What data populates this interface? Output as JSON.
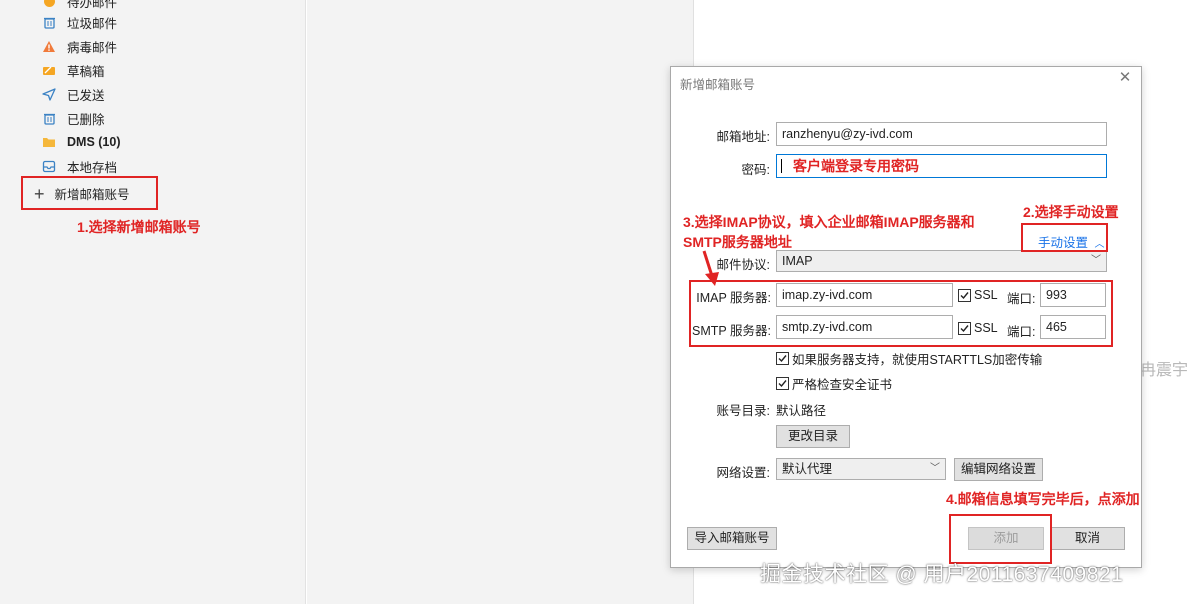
{
  "sidebar": {
    "folders": [
      {
        "label": "待办邮件",
        "icon": "todo-icon"
      },
      {
        "label": "垃圾邮件",
        "icon": "trash-icon"
      },
      {
        "label": "病毒邮件",
        "icon": "warning-icon"
      },
      {
        "label": "草稿箱",
        "icon": "draft-icon"
      },
      {
        "label": "已发送",
        "icon": "send-icon"
      },
      {
        "label": "已删除",
        "icon": "deleted-icon"
      },
      {
        "label": "DMS (10)",
        "icon": "folder-icon"
      },
      {
        "label": "本地存档",
        "icon": "archive-icon"
      }
    ],
    "add_account_label": "新增邮箱账号",
    "add_account_icon": "plus-icon"
  },
  "annotations": {
    "step1": "1.选择新增邮箱账号",
    "step2": "2.选择手动设置",
    "step3_line1": "3.选择IMAP协议，填入企业邮箱IMAP服务器和",
    "step3_line2": "SMTP服务器地址",
    "step4": "4.邮箱信息填写完毕后，点添加",
    "color": "#e02424"
  },
  "dialog": {
    "title": "新增邮箱账号",
    "close_icon": "close-icon",
    "email_label": "邮箱地址:",
    "email_value": "ranzhenyu@zy-ivd.com",
    "password_label": "密码:",
    "password_value": "客户端登录专用密码",
    "manual_label": "手动设置",
    "protocol_label": "邮件协议:",
    "protocol_value": "IMAP",
    "imap_label": "IMAP 服务器:",
    "imap_value": "imap.zy-ivd.com",
    "imap_ssl": "SSL",
    "imap_port_label": "端口:",
    "imap_port": "993",
    "smtp_label": "SMTP 服务器:",
    "smtp_value": "smtp.zy-ivd.com",
    "smtp_ssl": "SSL",
    "smtp_port_label": "端口:",
    "smtp_port": "465",
    "starttls_label": "如果服务器支持，就使用STARTTLS加密传输",
    "strict_cert_label": "严格检查安全证书",
    "account_dir_label": "账号目录:",
    "account_dir_value": "默认路径",
    "change_dir_button": "更改目录",
    "network_label": "网络设置:",
    "network_value": "默认代理",
    "edit_network_button": "编辑网络设置",
    "import_button": "导入邮箱账号",
    "add_button": "添加",
    "cancel_button": "取消"
  },
  "watermark": "掘金技术社区 @ 用户2011637409821",
  "background_fragment": "冉震宇"
}
